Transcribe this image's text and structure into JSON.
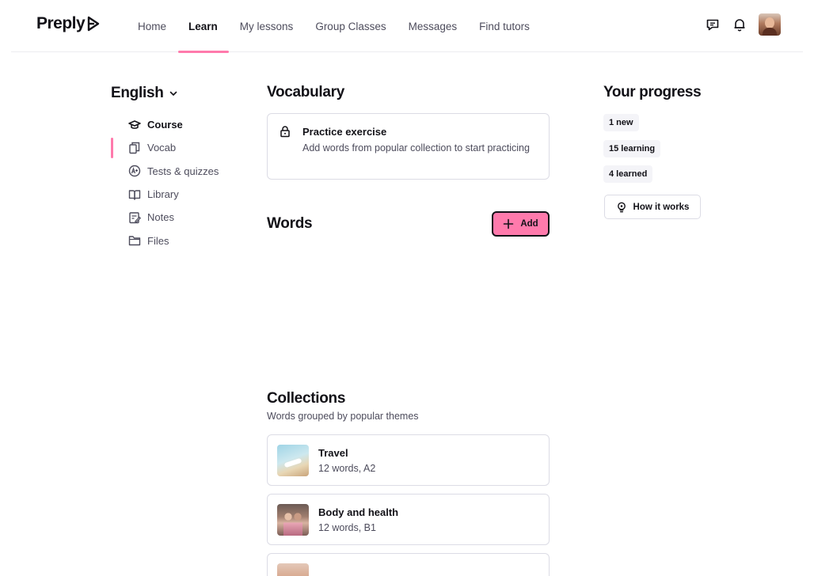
{
  "brand": {
    "name": "Preply"
  },
  "nav": {
    "items": [
      {
        "label": "Home"
      },
      {
        "label": "Learn"
      },
      {
        "label": "My lessons"
      },
      {
        "label": "Group Classes"
      },
      {
        "label": "Messages"
      },
      {
        "label": "Find tutors"
      }
    ],
    "active": "Learn"
  },
  "sidebar": {
    "language": "English",
    "items": [
      {
        "label": "Course",
        "icon": "graduation-cap-icon"
      },
      {
        "label": "Vocab",
        "icon": "cards-icon"
      },
      {
        "label": "Tests & quizzes",
        "icon": "grade-a-plus-icon"
      },
      {
        "label": "Library",
        "icon": "book-icon"
      },
      {
        "label": "Notes",
        "icon": "notes-icon"
      },
      {
        "label": "Files",
        "icon": "folder-icon"
      }
    ]
  },
  "vocabulary": {
    "title": "Vocabulary",
    "practice": {
      "title": "Practice exercise",
      "description": "Add words from popular collection to start practicing"
    }
  },
  "words": {
    "title": "Words",
    "add_label": "Add"
  },
  "collections": {
    "title": "Collections",
    "subtitle": "Words grouped by popular themes",
    "items": [
      {
        "title": "Travel",
        "meta": "12 words, A2"
      },
      {
        "title": "Body and health",
        "meta": "12 words, B1"
      }
    ]
  },
  "progress": {
    "title": "Your progress",
    "new": "1 new",
    "learning": "15 learning",
    "learned": "4 learned",
    "how_label": "How it works"
  },
  "colors": {
    "accent": "#ff7aac",
    "text": "#121117",
    "muted": "#4d4c5c",
    "border": "#dcdce5"
  }
}
